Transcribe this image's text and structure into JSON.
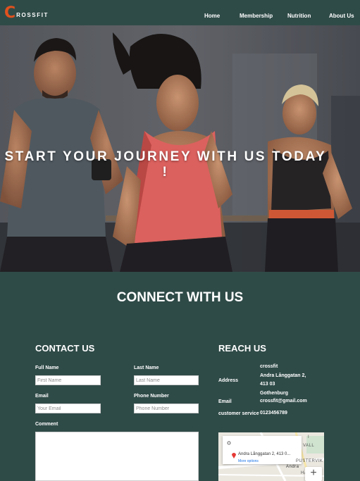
{
  "brand": {
    "logo_letter": "C",
    "logo_rest": "ROSSFIT",
    "accent": "#e0521e"
  },
  "nav": {
    "home": "Home",
    "membership": "Membership",
    "nutrition": "Nutrition",
    "about": "About Us"
  },
  "hero": {
    "title": "START YOUR JOURNEY WITH US TODAY !"
  },
  "connect": {
    "title": "CONNECT WITH US"
  },
  "contact": {
    "title": "CONTACT US",
    "full_name_label": "Full Name",
    "full_name_placeholder": "First Name",
    "last_name_label": "Last Name",
    "last_name_placeholder": "Last Name",
    "email_label": "Email",
    "email_placeholder": "Your Email",
    "phone_label": "Phone Number",
    "phone_placeholder": "Phone Number",
    "comment_label": "Comment"
  },
  "reach": {
    "title": "REACH US",
    "address_label": "Address",
    "address_lines": [
      "crossfit",
      "Andra Långgatan 2,",
      "413 03",
      "Gothenburg"
    ],
    "email_label": "Email",
    "email_value": "crossfit@gmail.com",
    "service_label": "customer service",
    "service_value": "0123456789"
  },
  "map": {
    "address": "Andra Långgatan 2, 413 0...",
    "more_options": "More options",
    "label_vall": "VALL",
    "label_pustervik": "PUSTERVIK",
    "label_andra": "Andra",
    "label_ha": "HA",
    "label_i": "I",
    "zoom_in": "+"
  },
  "colors": {
    "background": "#2f4b48",
    "text": "#ffffff"
  }
}
